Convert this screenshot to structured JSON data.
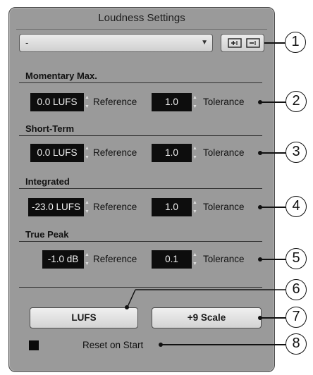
{
  "panel": {
    "title": "Loudness Settings",
    "preset_value": "-"
  },
  "sections": [
    {
      "title": "Momentary Max.",
      "reference_value": "0.0 LUFS",
      "reference_label": "Reference",
      "tolerance_value": "1.0",
      "tolerance_label": "Tolerance"
    },
    {
      "title": "Short-Term",
      "reference_value": "0.0 LUFS",
      "reference_label": "Reference",
      "tolerance_value": "1.0",
      "tolerance_label": "Tolerance"
    },
    {
      "title": "Integrated",
      "reference_value": "-23.0 LUFS",
      "reference_label": "Reference",
      "tolerance_value": "1.0",
      "tolerance_label": "Tolerance"
    },
    {
      "title": "True Peak",
      "reference_value": "-1.0 dB",
      "reference_label": "Reference",
      "tolerance_value": "0.1",
      "tolerance_label": "Tolerance"
    }
  ],
  "buttons": {
    "unit_label": "LUFS",
    "scale_label": "+9 Scale"
  },
  "reset": {
    "label": "Reset on Start",
    "checked": true
  },
  "callouts": [
    "1",
    "2",
    "3",
    "4",
    "5",
    "6",
    "7",
    "8"
  ],
  "icons": {
    "save_preset": "save-preset-icon",
    "delete_preset": "delete-preset-icon",
    "dropdown": "chevron-down-icon"
  }
}
